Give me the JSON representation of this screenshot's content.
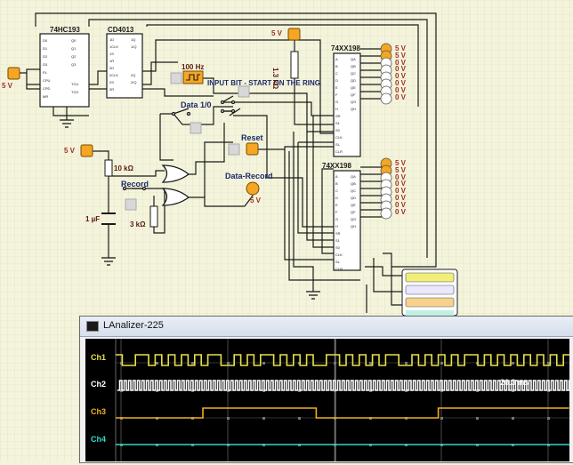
{
  "chips": {
    "counter": "74HC193",
    "flipflop": "CD4013",
    "shift1": "74XX198",
    "shift2": "74XX198"
  },
  "power": {
    "left": "5 V",
    "top": "5 V",
    "mid": "5 V",
    "record_led": "5 V"
  },
  "labels": {
    "clock": "100 Hz",
    "input_bit": "INPUT BIT - START ON THE RING",
    "data_toggle": "Data 1/0",
    "reset": "Reset",
    "record": "Record",
    "data_record": "Data-Record",
    "resistor_10k": "10 kΩ",
    "resistor_3k": "3 kΩ",
    "resistor_1_3k": "1.3 kΩ",
    "capacitor": "1 µF"
  },
  "led_column_1": [
    "5 V",
    "5 V",
    "0 V",
    "0 V",
    "0 V",
    "0 V",
    "0 V",
    "0 V"
  ],
  "led_column_2": [
    "5 V",
    "5 V",
    "0 V",
    "0 V",
    "0 V",
    "0 V",
    "0 V",
    "0 V"
  ],
  "counter_pins_left": [
    "D0",
    "D1",
    "D2",
    "D3",
    "PL",
    "CPU",
    "CPD",
    "MR"
  ],
  "counter_pins_right": [
    "Q0",
    "Q1",
    "Q2",
    "Q3",
    "TCU",
    "TCD"
  ],
  "ff_pins_left": [
    "1D",
    "1CLK",
    "1S",
    "1R",
    "2D",
    "2CLK",
    "2S",
    "2R"
  ],
  "ff_pins_right": [
    "1Q",
    "1/Q",
    "2Q",
    "2/Q"
  ],
  "shift_pins_left": [
    "A",
    "B",
    "C",
    "D",
    "E",
    "F",
    "G",
    "H",
    "SR",
    "S1",
    "S0",
    "CLK",
    "SL",
    "CLR"
  ],
  "shift_pins_right": [
    "QA",
    "QB",
    "QC",
    "QD",
    "QE",
    "QF",
    "QG",
    "QH"
  ],
  "analyzer": {
    "title": "LAnalizer-225",
    "channels": [
      {
        "label": "Ch1",
        "color": "#e8e04a"
      },
      {
        "label": "Ch2",
        "color": "#ffffff"
      },
      {
        "label": "Ch3",
        "color": "#f0b020"
      },
      {
        "label": "Ch4",
        "color": "#38d6c8"
      }
    ],
    "ch2_readout": "26.3 ms"
  },
  "colors": {
    "wire": "#1a1a1a",
    "led_off": "#ffffff",
    "led_on": "#f5a623",
    "source": "#f5a623",
    "grid": "#d8d8b8"
  }
}
